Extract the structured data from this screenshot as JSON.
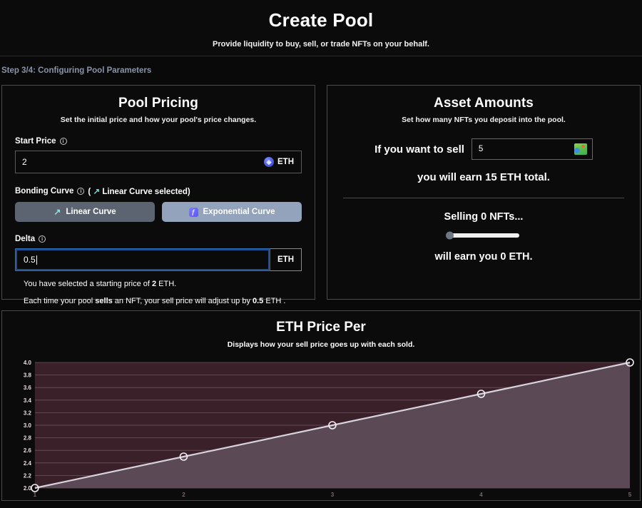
{
  "header": {
    "title": "Create Pool",
    "subtitle": "Provide liquidity to buy, sell, or trade NFTs on your behalf."
  },
  "step": {
    "label": "Step 3/4: Configuring Pool Parameters"
  },
  "pool_pricing": {
    "title": "Pool Pricing",
    "subtitle": "Set the initial price and how your pool's price changes.",
    "start_price": {
      "label": "Start Price",
      "info_icon": "info-icon",
      "value": "2",
      "placeholder": "0",
      "currency": "ETH",
      "coin_icon": "ethereum-icon"
    },
    "bonding_curve": {
      "label": "Bonding Curve",
      "info_icon": "info-icon",
      "selected_note": "( ↗ Linear Curve selected)",
      "selected_prefix": "(",
      "selected_arrow": "↗",
      "selected_text": "Linear Curve selected)",
      "options": [
        {
          "label": "Linear Curve",
          "icon": "trending-up-icon",
          "state": "default"
        },
        {
          "label": "Exponential Curve",
          "icon": "exponential-curve-icon",
          "state": "highlighted"
        }
      ]
    },
    "delta": {
      "label": "Delta",
      "info_icon": "info-icon",
      "value": "0.5",
      "placeholder": "0",
      "currency": "ETH",
      "focused": true
    },
    "notes": {
      "start_note_pre": "You have selected a starting price of ",
      "start_note_strong": "2",
      "start_note_post": " ETH.",
      "adjust_pre": "Each time your pool ",
      "adjust_verb": "sells",
      "adjust_mid": " an NFT, your sell price will adjust up by ",
      "adjust_strong": "0.5",
      "adjust_post": " ETH ."
    }
  },
  "asset_amounts": {
    "title": "Asset Amounts",
    "subtitle": "Set how many NFTs you deposit into the pool.",
    "sell_label": "If you want to sell",
    "nft_count": "5",
    "nft_placeholder": "0",
    "nft_icon": "nft-thumbnail-icon",
    "earn_pre": "you will earn ",
    "earn_strong": "15",
    "earn_post": " ETH total.",
    "selling_line": "Selling 0 NFTs...",
    "slider": {
      "value": 0,
      "min": 0,
      "max": 5
    },
    "earn_you_pre": "will earn you ",
    "earn_you_strong": "0",
    "earn_you_post": " ETH."
  },
  "chart_panel": {
    "title": "ETH Price Per",
    "subtitle": "Displays how your sell price goes up with each sold."
  },
  "chart_data": {
    "type": "line",
    "title": "ETH Price Per",
    "subtitle": "Displays how your sell price goes up with each sold.",
    "x": [
      1,
      2,
      3,
      4,
      5
    ],
    "xtick_labels": [
      "1",
      "2",
      "3",
      "4",
      "5"
    ],
    "values": [
      2.0,
      2.5,
      3.0,
      3.5,
      4.0
    ],
    "ytick_labels": [
      "4.0",
      "3.8",
      "3.6",
      "3.4",
      "3.2",
      "3.0",
      "2.8",
      "2.6",
      "2.4",
      "2.2",
      "2.0"
    ],
    "ylim": [
      2.0,
      4.0
    ],
    "xlim": [
      1,
      5
    ],
    "xlabel": "",
    "ylabel": "",
    "grid": true,
    "legend": "none",
    "markers": true,
    "colors": {
      "plot_background": "#3a2029",
      "area_fill": "#5b4a56",
      "line": "#d8d2de",
      "gridline": "#6e5460",
      "marker_stroke": "#f2eef2"
    }
  }
}
